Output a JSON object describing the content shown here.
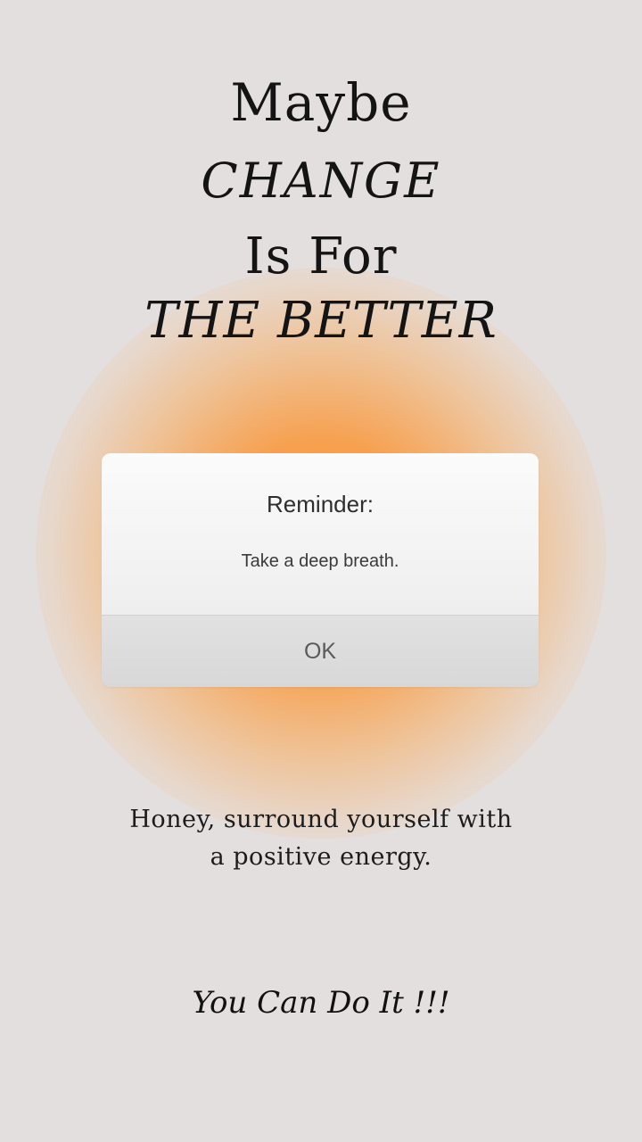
{
  "headline": {
    "line1": "Maybe",
    "line2": "CHANGE",
    "line3": "Is For",
    "line4": "THE BETTER"
  },
  "dialog": {
    "title": "Reminder:",
    "message": "Take a deep breath.",
    "ok_label": "OK"
  },
  "affirmation": {
    "line1": "Honey, surround yourself with",
    "line2": "a positive energy."
  },
  "closing": "You Can Do It !!!",
  "colors": {
    "background": "#e4dfdf",
    "glow": "#f59a3c",
    "text": "#141414"
  }
}
